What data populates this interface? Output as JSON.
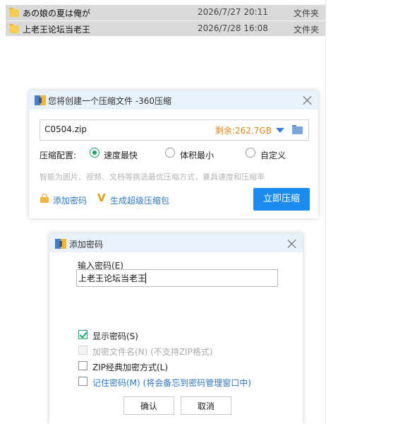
{
  "file_list": {
    "rows": [
      {
        "name": "あの娘の夏は俺が",
        "date": "2026/7/27 20:11",
        "type": "文件夹"
      },
      {
        "name": "上老王论坛当老王",
        "date": "2026/7/28 16:08",
        "type": "文件夹"
      }
    ]
  },
  "compress_dialog": {
    "title": "您将创建一个压缩文件 -360压缩",
    "filename": "C0504.zip",
    "free_space": "剩余:262.7GB",
    "config_label": "压缩配置:",
    "options": [
      {
        "label": "速度最快",
        "selected": true
      },
      {
        "label": "体积最小",
        "selected": false
      },
      {
        "label": "自定义",
        "selected": false
      }
    ],
    "hint": "智能为图片、视频、文档等挑选最优压缩方式，兼具速度和压缩率",
    "add_password_link": "添加密码",
    "super_package_link": "生成超级压缩包",
    "compress_button": "立即压缩"
  },
  "password_dialog": {
    "title": "添加密码",
    "password_label": "输入密码(E)",
    "password_value": "上老王论坛当老王",
    "checkboxes": [
      {
        "label": "显示密码(S)",
        "checked": true,
        "disabled": false
      },
      {
        "label": "加密文件名(N) (不支持ZIP格式)",
        "checked": false,
        "disabled": true
      },
      {
        "label": "ZIP经典加密方式(L)",
        "checked": false,
        "disabled": false
      },
      {
        "label": "记住密码(M) (将会备忘到密码管理窗口中)",
        "checked": false,
        "disabled": false
      }
    ],
    "ok_button": "确认",
    "cancel_button": "取消"
  },
  "colors": {
    "accent_blue": "#1a8cf0",
    "link_blue": "#2f78c4",
    "orange": "#e0871e",
    "green": "#1aa260"
  }
}
